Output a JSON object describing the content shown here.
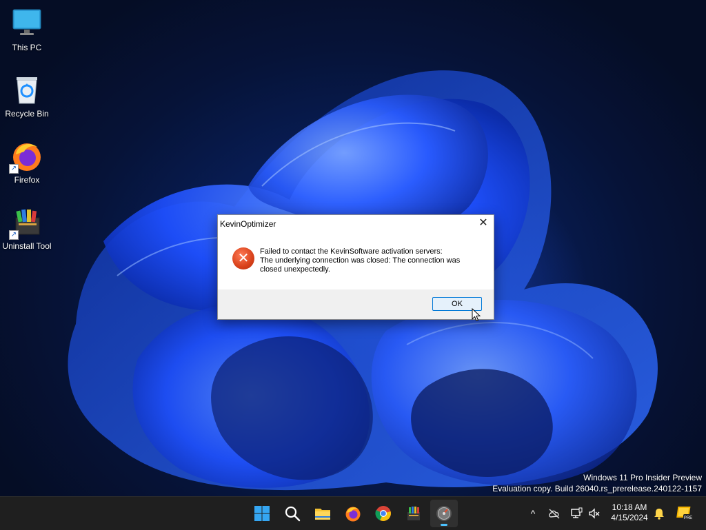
{
  "desktop": {
    "icons": [
      {
        "label": "This PC"
      },
      {
        "label": "Recycle Bin"
      },
      {
        "label": "Firefox"
      },
      {
        "label": "Uninstall Tool"
      }
    ],
    "watermark": {
      "line1": "Windows 11 Pro Insider Preview",
      "line2": "Evaluation copy. Build 26040.rs_prerelease.240122-1157"
    }
  },
  "dialog": {
    "title": "KevinOptimizer",
    "close_glyph": "✕",
    "icon": "error-icon",
    "message_lines": [
      "Failed to contact the KevinSoftware activation servers:",
      "The underlying connection was closed: The connection was",
      "closed unexpectedly."
    ],
    "ok_label": "OK"
  },
  "taskbar": {
    "apps": [
      {
        "name": "start-icon"
      },
      {
        "name": "search-icon"
      },
      {
        "name": "file-explorer-icon"
      },
      {
        "name": "firefox-icon"
      },
      {
        "name": "chrome-icon"
      },
      {
        "name": "uninstall-tool-icon"
      },
      {
        "name": "kevin-optimizer-icon",
        "active": true
      }
    ],
    "tray": {
      "chevron": "^",
      "time": "10:18 AM",
      "date": "4/15/2024",
      "pre_badge": "PRE"
    }
  },
  "colors": {
    "accent": "#0078d7",
    "error_red": "#d8411a",
    "taskbar_bg": "#1f1f1f",
    "wallpaper_blue": "#1e4fff"
  }
}
